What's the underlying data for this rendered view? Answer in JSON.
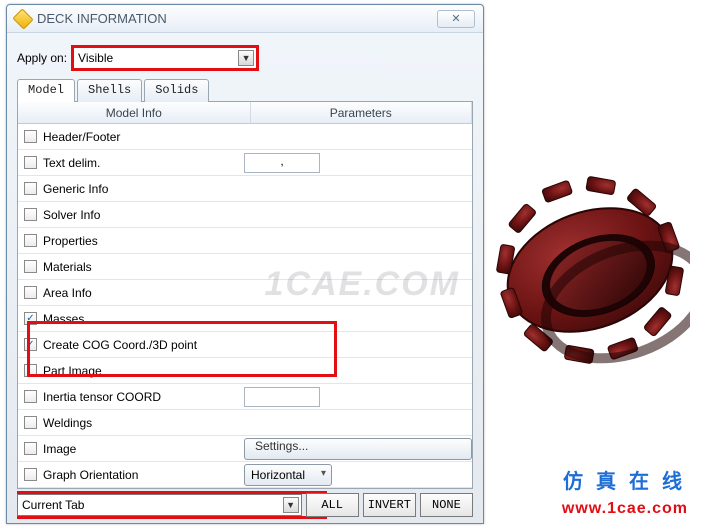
{
  "dialog": {
    "title": "DECK INFORMATION",
    "close_glyph": "✕",
    "apply_label": "Apply on:",
    "apply_value": "Visible"
  },
  "tabs": {
    "model": "Model",
    "shells": "Shells",
    "solids": "Solids"
  },
  "grid": {
    "headers": {
      "info": "Model Info",
      "params": "Parameters"
    },
    "rows": [
      {
        "key": "header_footer",
        "label": "Header/Footer",
        "checked": false,
        "param": null
      },
      {
        "key": "text_delim",
        "label": "Text delim.",
        "checked": false,
        "param": ","
      },
      {
        "key": "generic_info",
        "label": "Generic Info",
        "checked": false,
        "param": null
      },
      {
        "key": "solver_info",
        "label": "Solver Info",
        "checked": false,
        "param": null
      },
      {
        "key": "properties",
        "label": "Properties",
        "checked": false,
        "param": null
      },
      {
        "key": "materials",
        "label": "Materials",
        "checked": false,
        "param": null
      },
      {
        "key": "area_info",
        "label": "Area Info",
        "checked": false,
        "param": null
      },
      {
        "key": "masses",
        "label": "Masses",
        "checked": true,
        "param": null,
        "highlight": true
      },
      {
        "key": "create_cog",
        "label": "Create COG Coord./3D point",
        "checked": true,
        "param": null,
        "highlight": true
      },
      {
        "key": "part_image",
        "label": "Part Image",
        "checked": false,
        "param": null
      },
      {
        "key": "inertia_tensor",
        "label": "Inertia tensor COORD",
        "checked": false,
        "param": ""
      },
      {
        "key": "weldings",
        "label": "Weldings",
        "checked": false,
        "param": null
      },
      {
        "key": "image",
        "label": "Image",
        "checked": false,
        "special": "settings"
      },
      {
        "key": "graph_orientation",
        "label": "Graph Orientation",
        "checked": false,
        "special": "orientation"
      }
    ]
  },
  "buttons": {
    "settings": "Settings...",
    "orientation": "Horizontal"
  },
  "bottom": {
    "scope": "Current Tab",
    "all": "ALL",
    "invert": "INVERT",
    "none": "NONE"
  },
  "branding": {
    "watermark": "1CAE.COM",
    "caption": "仿 真 在 线",
    "url": "www.1cae.com"
  }
}
